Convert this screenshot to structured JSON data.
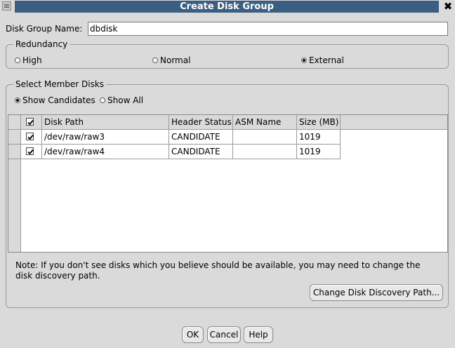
{
  "window": {
    "title": "Create Disk Group",
    "close_glyph": "✖"
  },
  "form": {
    "name_label": "Disk Group Name:",
    "name_value": "dbdisk"
  },
  "redundancy": {
    "legend": "Redundancy",
    "options": [
      {
        "label": "High",
        "selected": false
      },
      {
        "label": "Normal",
        "selected": false
      },
      {
        "label": "External",
        "selected": true
      }
    ]
  },
  "member_disks": {
    "legend": "Select Member Disks",
    "filters": [
      {
        "label": "Show Candidates",
        "selected": true
      },
      {
        "label": "Show All",
        "selected": false
      }
    ],
    "columns": [
      "Disk Path",
      "Header Status",
      "ASM Name",
      "Size (MB)"
    ],
    "header_checked": true,
    "rows": [
      {
        "checked": true,
        "disk_path": "/dev/raw/raw3",
        "header_status": "CANDIDATE",
        "asm_name": "",
        "size": "1019"
      },
      {
        "checked": true,
        "disk_path": "/dev/raw/raw4",
        "header_status": "CANDIDATE",
        "asm_name": "",
        "size": "1019"
      }
    ],
    "note": "Note: If you don't see disks which you believe should be available, you may need to change the disk discovery path.",
    "change_path_button": "Change Disk Discovery Path..."
  },
  "buttons": {
    "ok": "OK",
    "cancel": "Cancel",
    "help": "Help"
  },
  "icons": {
    "window_menu": "window-menu-icon",
    "close": "close-icon",
    "checkbox": "checkmark-icon"
  }
}
